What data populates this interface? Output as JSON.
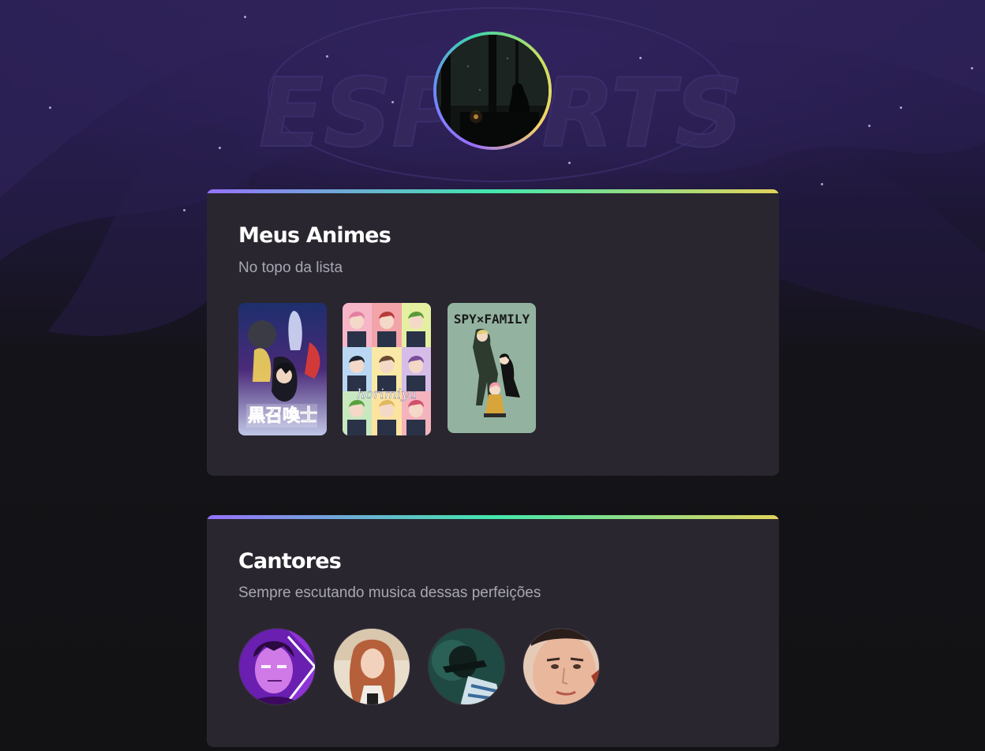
{
  "profile": {
    "avatar_alt": "profile-photo"
  },
  "animes": {
    "title": "Meus Animes",
    "subtitle": "No topo da lista",
    "items": [
      {
        "name": "black-summoner-poster",
        "logo_text": "黒召喚士"
      },
      {
        "name": "horimiya-poster",
        "logo_text": "horimiya"
      },
      {
        "name": "spy-family-poster",
        "logo_text": "SPY×FAMILY"
      }
    ]
  },
  "singers": {
    "title": "Cantores",
    "subtitle": "Sempre escutando musica dessas perfeições",
    "items": [
      {
        "name": "singer-1-avatar"
      },
      {
        "name": "singer-2-avatar"
      },
      {
        "name": "singer-3-avatar"
      },
      {
        "name": "singer-4-avatar"
      }
    ]
  },
  "colors": {
    "background": "#121214",
    "card": "#29262f",
    "gradient_start": "#9572fc",
    "gradient_mid": "#43e7ad",
    "gradient_end": "#e2d45c",
    "title": "#ffffff",
    "subtitle": "#a8a8b3"
  },
  "background_watermark": "ESPORTS"
}
